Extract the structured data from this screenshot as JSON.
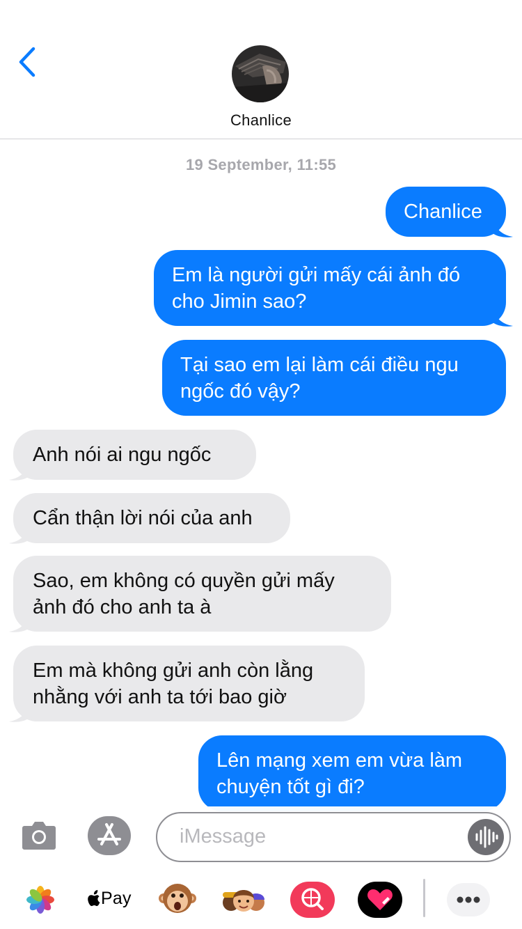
{
  "header": {
    "contact_name": "Chanlice",
    "back_icon": "chevron-left-icon",
    "avatar": "contact-avatar-photo"
  },
  "timestamp": "19 September, 11:55",
  "messages": [
    {
      "direction": "outgoing",
      "lines": [
        "Chanlice"
      ]
    },
    {
      "direction": "outgoing",
      "lines": [
        "Em là người gửi mấy cái ảnh đó",
        "cho Jimin sao?"
      ]
    },
    {
      "direction": "outgoing",
      "lines": [
        "Tại sao em lại làm cái điều ngu",
        "ngốc đó vậy?"
      ]
    },
    {
      "direction": "incoming",
      "lines": [
        "Anh nói ai ngu ngốc"
      ]
    },
    {
      "direction": "incoming",
      "lines": [
        "Cẩn thận lời nói của anh"
      ]
    },
    {
      "direction": "incoming",
      "lines": [
        "Sao, em không có quyền gửi mấy",
        "ảnh đó cho anh ta à"
      ]
    },
    {
      "direction": "incoming",
      "lines": [
        "Em mà không gửi anh còn lằng",
        "nhằng với anh ta tới bao giờ"
      ]
    },
    {
      "direction": "outgoing",
      "lines": [
        "Lên mạng xem em vừa làm",
        "chuyện tốt gì đi?"
      ]
    }
  ],
  "composer": {
    "placeholder": "iMessage",
    "camera_icon": "camera-icon",
    "appstore_icon": "app-store-icon",
    "audio_icon": "audio-waveform-icon"
  },
  "app_drawer": {
    "apple_pay_label": "Pay",
    "icons": [
      "photos-icon",
      "apple-pay-icon",
      "animoji-monkey-icon",
      "memoji-stickers-icon",
      "web-image-search-icon",
      "digital-touch-icon",
      "more-apps-icon"
    ]
  },
  "colors": {
    "outgoing_bubble": "#0a7cff",
    "incoming_bubble": "#e9e9eb",
    "accent": "#0a7cff",
    "battery": "#4cd964"
  }
}
